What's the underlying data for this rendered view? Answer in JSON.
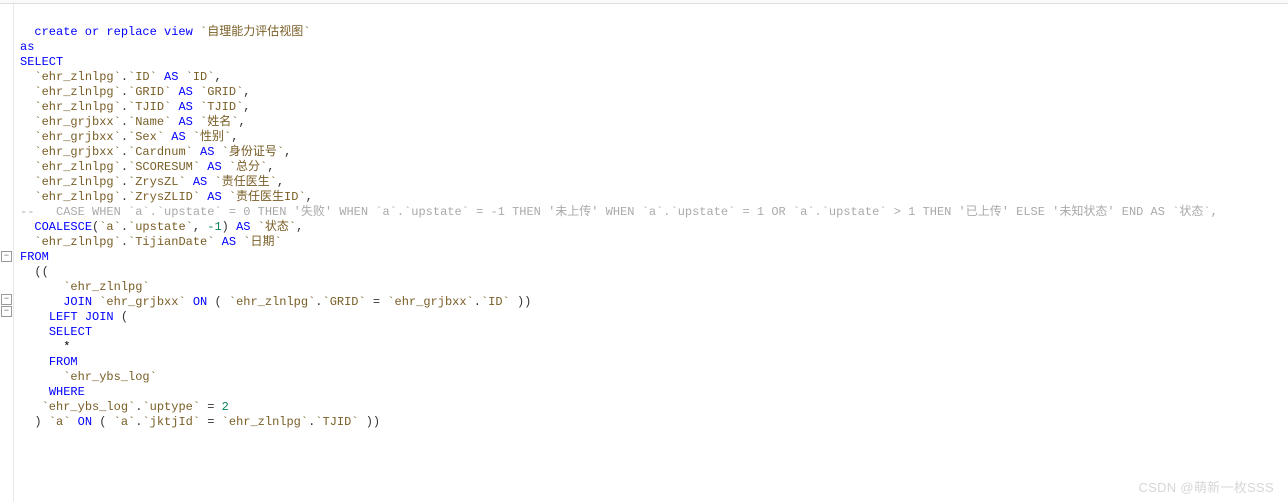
{
  "watermark": "CSDN @萌新一枚SSS",
  "fold_glyph": "−",
  "code": {
    "l01": {
      "a": "  create or replace view",
      "b": " `自理能力评估视图`"
    },
    "l02": "as",
    "l03": "SELECT",
    "l04": {
      "tbl": "`ehr_zlnlpg`",
      "col": "`ID`",
      "as": "AS",
      "al": "`ID`"
    },
    "l05": {
      "tbl": "`ehr_zlnlpg`",
      "col": "`GRID`",
      "as": "AS",
      "al": "`GRID`"
    },
    "l06": {
      "tbl": "`ehr_zlnlpg`",
      "col": "`TJID`",
      "as": "AS",
      "al": "`TJID`"
    },
    "l07": {
      "tbl": "`ehr_grjbxx`",
      "col": "`Name`",
      "as": "AS",
      "al": "`姓名`"
    },
    "l08": {
      "tbl": "`ehr_grjbxx`",
      "col": "`Sex`",
      "as": "AS",
      "al": "`性别`"
    },
    "l09": {
      "tbl": "`ehr_grjbxx`",
      "col": "`Cardnum`",
      "as": "AS",
      "al": "`身份证号`"
    },
    "l10": {
      "tbl": "`ehr_zlnlpg`",
      "col": "`SCORESUM`",
      "as": "AS",
      "al": "`总分`"
    },
    "l11": {
      "tbl": "`ehr_zlnlpg`",
      "col": "`ZrysZL`",
      "as": "AS",
      "al": "`责任医生`"
    },
    "l12": {
      "tbl": "`ehr_zlnlpg`",
      "col": "`ZrysZLID`",
      "as": "AS",
      "al": "`责任医生ID`"
    },
    "l13": "--   CASE WHEN `a`.`upstate` = 0 THEN '失败' WHEN `a`.`upstate` = -1 THEN '未上传' WHEN `a`.`upstate` = 1 OR `a`.`upstate` > 1 THEN '已上传' ELSE '未知状态' END AS `状态`,",
    "l14": {
      "fn": "COALESCE",
      "a": "`a`",
      "col": "`upstate`",
      "num": "-1",
      "as": "AS",
      "al": "`状态`"
    },
    "l15": {
      "tbl": "`ehr_zlnlpg`",
      "col": "`TijianDate`",
      "as": "AS",
      "al": "`日期`"
    },
    "l16": "FROM",
    "l17": "  ((",
    "l18": "      `ehr_zlnlpg`",
    "l19": {
      "j": "JOIN",
      "t": "`ehr_grjbxx`",
      "on": "ON",
      "p1": "`ehr_zlnlpg`",
      "c1": "`GRID`",
      "p2": "`ehr_grjbxx`",
      "c2": "`ID`"
    },
    "l20": {
      "lj": "LEFT JOIN"
    },
    "l21": "SELECT",
    "l22": "      *",
    "l23": "FROM",
    "l24": "      `ehr_ybs_log`",
    "l25": "WHERE",
    "l26": {
      "t": "`ehr_ybs_log`",
      "c": "`uptype`",
      "n": "2"
    },
    "l27": {
      "a": "`a`",
      "on": "ON",
      "p1": "`a`",
      "c1": "`jktjId`",
      "p2": "`ehr_zlnlpg`",
      "c2": "`TJID`"
    }
  }
}
